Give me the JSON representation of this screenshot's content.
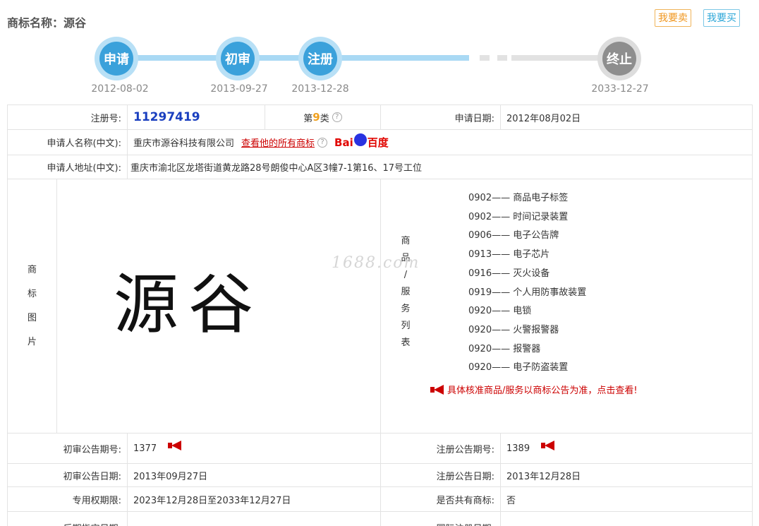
{
  "header": {
    "title": "商标名称：源谷",
    "sell_button": "我要卖",
    "buy_button": "我要买"
  },
  "timeline": [
    {
      "label": "申请",
      "date": "2012-08-02"
    },
    {
      "label": "初审",
      "date": "2013-09-27"
    },
    {
      "label": "注册",
      "date": "2013-12-28"
    },
    {
      "label": "终止",
      "date": "2033-12-27"
    }
  ],
  "info": {
    "reg_no_label": "注册号:",
    "reg_no": "11297419",
    "class_prefix": "第",
    "class_num": "9",
    "class_suffix": "类",
    "help_mark": "?",
    "apply_date_label": "申请日期:",
    "apply_date": "2012年08月02日",
    "applicant_label": "申请人名称(中文):",
    "applicant": "重庆市源谷科技有限公司",
    "all_tm_link": "查看他的所有商标",
    "baidu_prefix": "Bai",
    "baidu_suffix": "百度",
    "address_label": "申请人地址(中文):",
    "address": "重庆市渝北区龙塔街道黄龙路28号朗俊中心A区3幢7-1第16、17号工位"
  },
  "mark": {
    "image_label": [
      "商",
      "标",
      "图",
      "片"
    ],
    "image_text": "源谷",
    "watermark": "1688.com",
    "service_label": [
      "商",
      "品",
      "/",
      "服",
      "务",
      "列",
      "表"
    ],
    "services": [
      "0902—— 商品电子标签",
      "0902—— 时间记录装置",
      "0906—— 电子公告牌",
      "0913—— 电子芯片",
      "0916—— 灭火设备",
      "0919—— 个人用防事故装置",
      "0920—— 电锁",
      "0920—— 火警报警器",
      "0920—— 报警器",
      "0920—— 电子防盗装置"
    ],
    "notice": "具体核准商品/服务以商标公告为准，点击查看!"
  },
  "publication": {
    "prelim_no_label": "初审公告期号:",
    "prelim_no": "1377",
    "reg_no_label": "注册公告期号:",
    "reg_no": "1389",
    "prelim_date_label": "初审公告日期:",
    "prelim_date": "2013年09月27日",
    "reg_date_label": "注册公告日期:",
    "reg_date": "2013年12月28日",
    "term_label": "专用权期限:",
    "term": "2023年12月28日至2033年12月27日",
    "shared_label": "是否共有商标:",
    "shared": "否",
    "later_label": "后期指定日期:",
    "intl_label": "国际注册日期:"
  },
  "colors": {
    "progress_active": "#3aa1db",
    "progress_inactive": "#8e8e8e",
    "registration_no": "#1a3fbf",
    "link_red": "#cc0000"
  }
}
